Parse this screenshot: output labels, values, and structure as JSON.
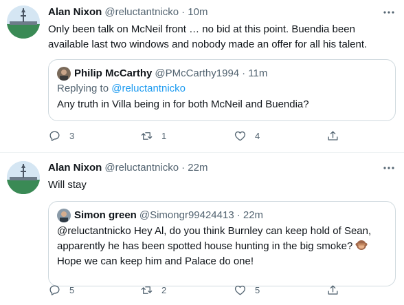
{
  "tweets": [
    {
      "author": "Alan Nixon",
      "handle": "@reluctantnicko",
      "time": "· 10m",
      "text": "Only been talk on McNeil front … no bid at this point. Buendia been available last two windows and nobody made an offer for all his talent.",
      "quote": {
        "author": "Philip McCarthy",
        "handle": "@PMcCarthy1994",
        "time": "· 11m",
        "replying_prefix": "Replying to ",
        "replying_handle": "@reluctantnicko",
        "text": "Any truth in Villa being in for both McNeil and Buendia?"
      },
      "counts": {
        "replies": "3",
        "retweets": "1",
        "likes": "4"
      }
    },
    {
      "author": "Alan Nixon",
      "handle": "@reluctantnicko",
      "time": "· 22m",
      "text": "Will stay",
      "quote": {
        "author": "Simon green",
        "handle": "@Simongr99424413",
        "time": "· 22m",
        "text_1": "@reluctantnicko Hey Al, do you think Burnley can keep hold of Sean, apparently he has been spotted house hunting in the big smoke?",
        "text_2": "Hope we can keep him and Palace do one!",
        "emoji": "see-no-evil-monkey"
      },
      "counts": {
        "replies": "5",
        "retweets": "2",
        "likes": "5"
      }
    }
  ],
  "icons": {
    "reply": "reply-icon",
    "retweet": "retweet-icon",
    "like": "heart-icon",
    "share": "share-icon",
    "more": "more-icon"
  },
  "colors": {
    "text": "#0f1419",
    "secondary": "#536471",
    "link": "#1d9bf0",
    "border": "#cfd9de"
  }
}
